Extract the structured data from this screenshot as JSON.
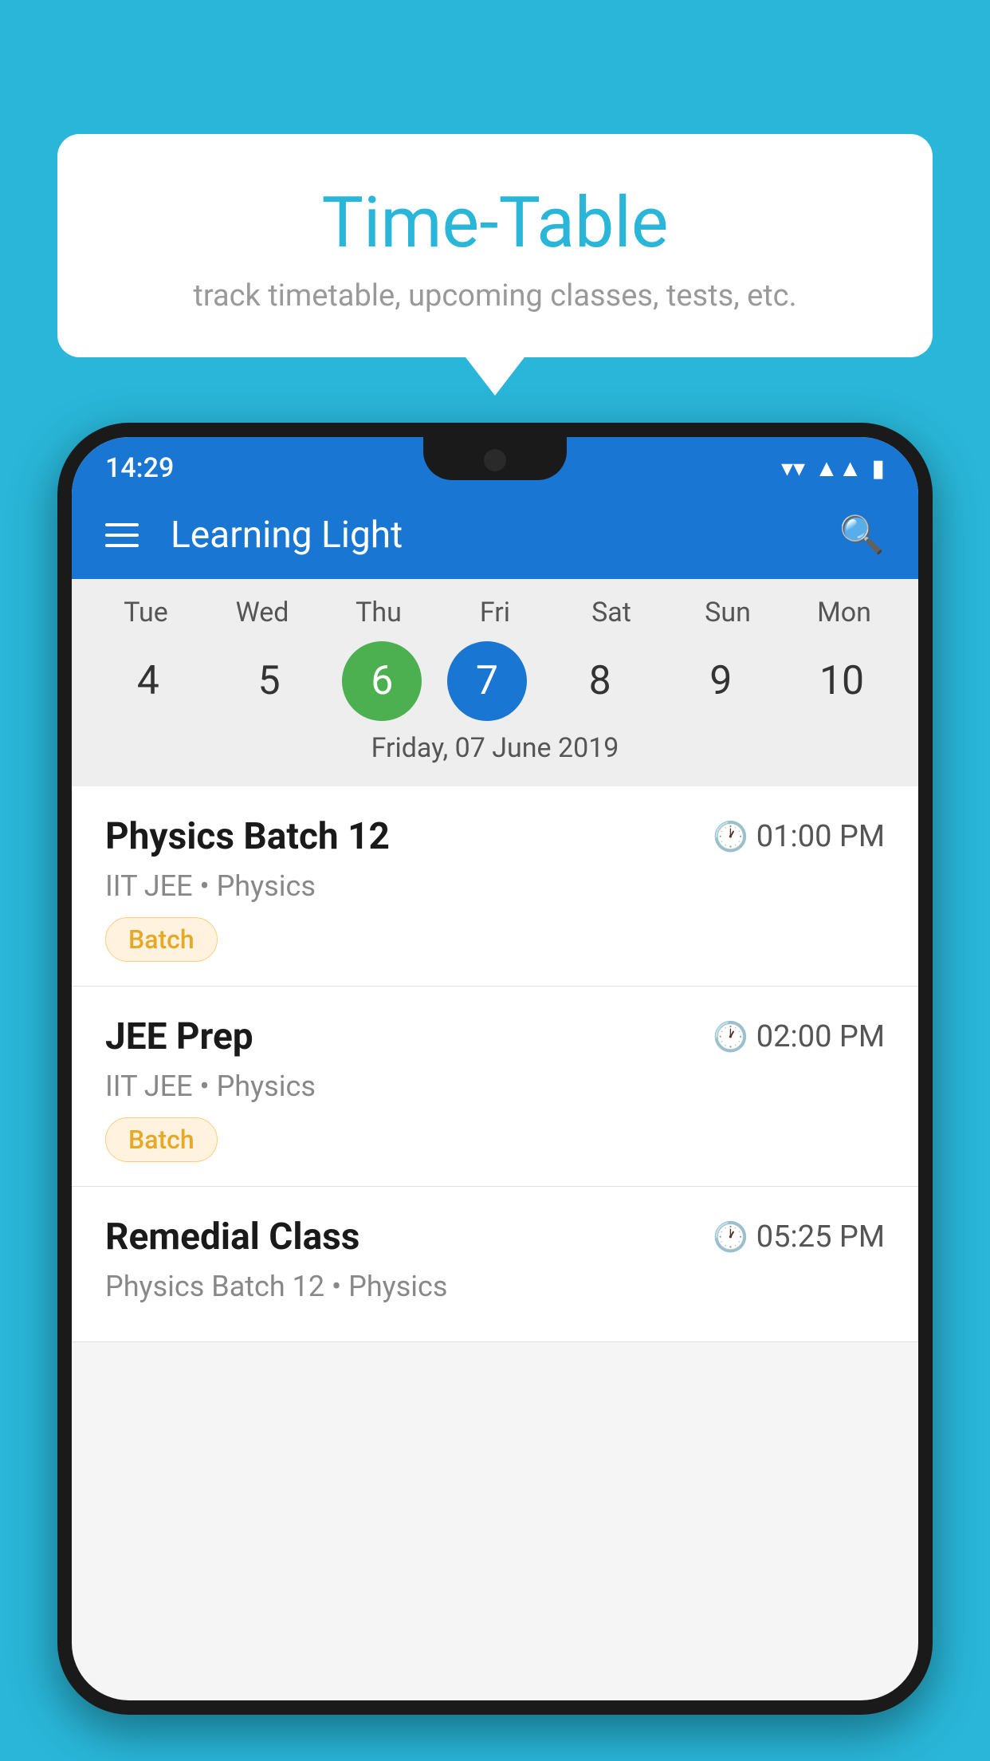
{
  "page": {
    "background_color": "#29b6d8"
  },
  "bubble": {
    "title": "Time-Table",
    "subtitle": "track timetable, upcoming classes, tests, etc."
  },
  "status_bar": {
    "time": "14:29"
  },
  "app_bar": {
    "title": "Learning Light"
  },
  "calendar": {
    "days": [
      {
        "label": "Tue",
        "number": "4"
      },
      {
        "label": "Wed",
        "number": "5"
      },
      {
        "label": "Thu",
        "number": "6",
        "state": "today"
      },
      {
        "label": "Fri",
        "number": "7",
        "state": "selected"
      },
      {
        "label": "Sat",
        "number": "8"
      },
      {
        "label": "Sun",
        "number": "9"
      },
      {
        "label": "Mon",
        "number": "10"
      }
    ],
    "selected_date_label": "Friday, 07 June 2019"
  },
  "schedule": {
    "items": [
      {
        "title": "Physics Batch 12",
        "time": "01:00 PM",
        "subtitle": "IIT JEE • Physics",
        "badge": "Batch"
      },
      {
        "title": "JEE Prep",
        "time": "02:00 PM",
        "subtitle": "IIT JEE • Physics",
        "badge": "Batch"
      },
      {
        "title": "Remedial Class",
        "time": "05:25 PM",
        "subtitle": "Physics Batch 12 • Physics",
        "badge": null
      }
    ]
  }
}
